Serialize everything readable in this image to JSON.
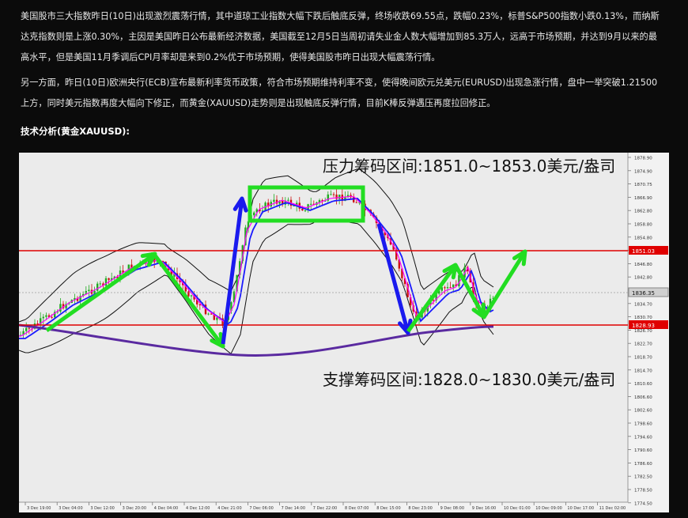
{
  "article": {
    "p1": "美国股市三大指数昨日(10日)出现激烈震荡行情，其中道琼工业指数大幅下跌后触底反弹，终场收跌69.55点，跌幅0.23%，标普S&P500指数小跌0.13%，而纳斯达克指数则是上涨0.30%，主因是美国昨日公布最新经济数据，美国截至12月5日当周初请失业金人数大幅增加到85.3万人，远高于市场预期，并达到9月以来的最高水平，但是美国11月季调后CPI月率却是来到0.2%优于市场预期，使得美国股市昨日出现大幅震荡行情。",
    "p2": "另一方面，昨日(10日)欧洲央行(ECB)宣布最新利率货币政策，符合市场预期维持利率不变，使得晚间欧元兑美元(EURUSD)出现急涨行情，盘中一举突破1.21500上方，同时美元指数再度大幅向下修正，而黄金(XAUUSD)走势则是出现触底反弹行情，目前K棒反弹遇压再度拉回修正。",
    "section_title": "技术分析(黄金XAUUSD):"
  },
  "chart": {
    "resistance_label": "压力筹码区间:1851.0~1853.0美元/盎司",
    "support_label": "支撑筹码区间:1828.0~1830.0美元/盎司",
    "price_ticks": [
      "1878.90",
      "1874.90",
      "1870.75",
      "1866.90",
      "1862.80",
      "1858.80",
      "1854.80",
      "1850.70",
      "1846.80",
      "1842.80",
      "1838.80",
      "1834.70",
      "1830.70",
      "1826.70",
      "1822.70",
      "1818.70",
      "1814.70",
      "1810.60",
      "1806.60",
      "1802.60",
      "1798.60",
      "1794.60",
      "1790.60",
      "1786.60",
      "1782.50",
      "1778.50",
      "1774.50"
    ],
    "resistance_tag": "1851.03",
    "support_tag": "1828.93",
    "current_tag": "1836.35",
    "time_ticks": [
      "3 Dec 19:00",
      "3 Dec 04:00",
      "3 Dec 12:00",
      "3 Dec 20:00",
      "4 Dec 04:00",
      "4 Dec 12:00",
      "4 Dec 21:00",
      "7 Dec 06:00",
      "7 Dec 14:00",
      "7 Dec 22:00",
      "8 Dec 07:00",
      "8 Dec 15:00",
      "8 Dec 23:00",
      "9 Dec 08:00",
      "9 Dec 16:00",
      "10 Dec 01:00",
      "10 Dec 09:00",
      "10 Dec 17:00",
      "11 Dec 02:00"
    ],
    "colors": {
      "resistance_line": "#e00000",
      "support_line": "#e00000",
      "arrow_green": "#22dd22",
      "arrow_blue": "#1a1aee",
      "box_green": "#22dd22",
      "trend_purple": "#5a2aa0",
      "ma_blue": "#1a1aff",
      "ma_magenta": "#ff00ff",
      "bollinger": "#111111"
    }
  }
}
